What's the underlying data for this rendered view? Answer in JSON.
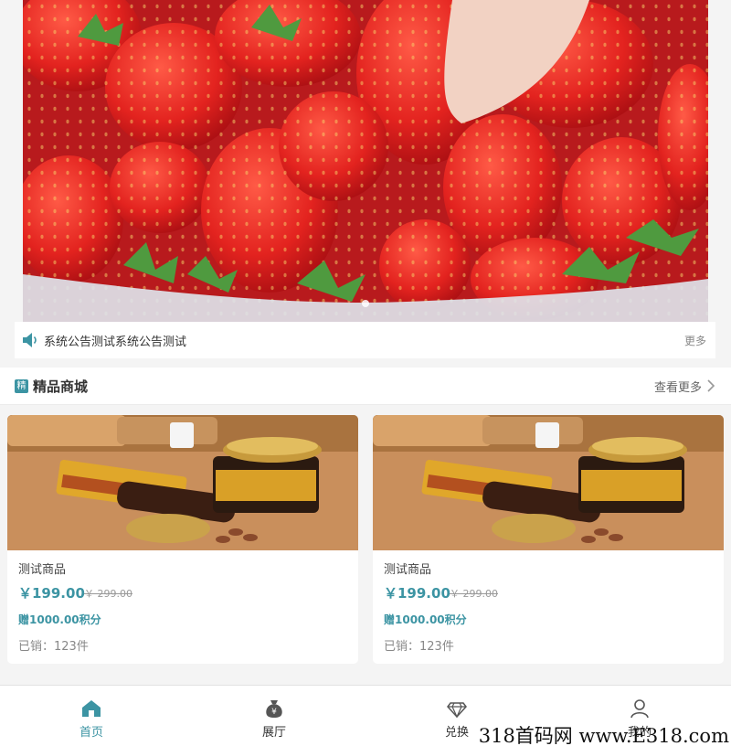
{
  "notice": {
    "text": "系统公告测试系统公告测试",
    "more": "更多"
  },
  "section": {
    "badge": "精",
    "title": "精品商城",
    "more": "查看更多"
  },
  "products": [
    {
      "name": "测试商品",
      "price": "￥199.00",
      "original_price": "￥ 299.00",
      "gift": "赠1000.00积分",
      "sold": "已销：123件"
    },
    {
      "name": "测试商品",
      "price": "￥199.00",
      "original_price": "￥ 299.00",
      "gift": "赠1000.00积分",
      "sold": "已销：123件"
    }
  ],
  "tabbar": {
    "active_index": 0,
    "items": [
      {
        "label": "首页",
        "icon": "home-icon"
      },
      {
        "label": "展厅",
        "icon": "coin-bag-icon"
      },
      {
        "label": "兑换",
        "icon": "diamond-icon"
      },
      {
        "label": "我的",
        "icon": "user-icon"
      }
    ]
  },
  "watermark": "318首码网 www.E318.com",
  "colors": {
    "accent": "#3c94a3",
    "text": "#333333",
    "background": "#f4f4f4"
  }
}
